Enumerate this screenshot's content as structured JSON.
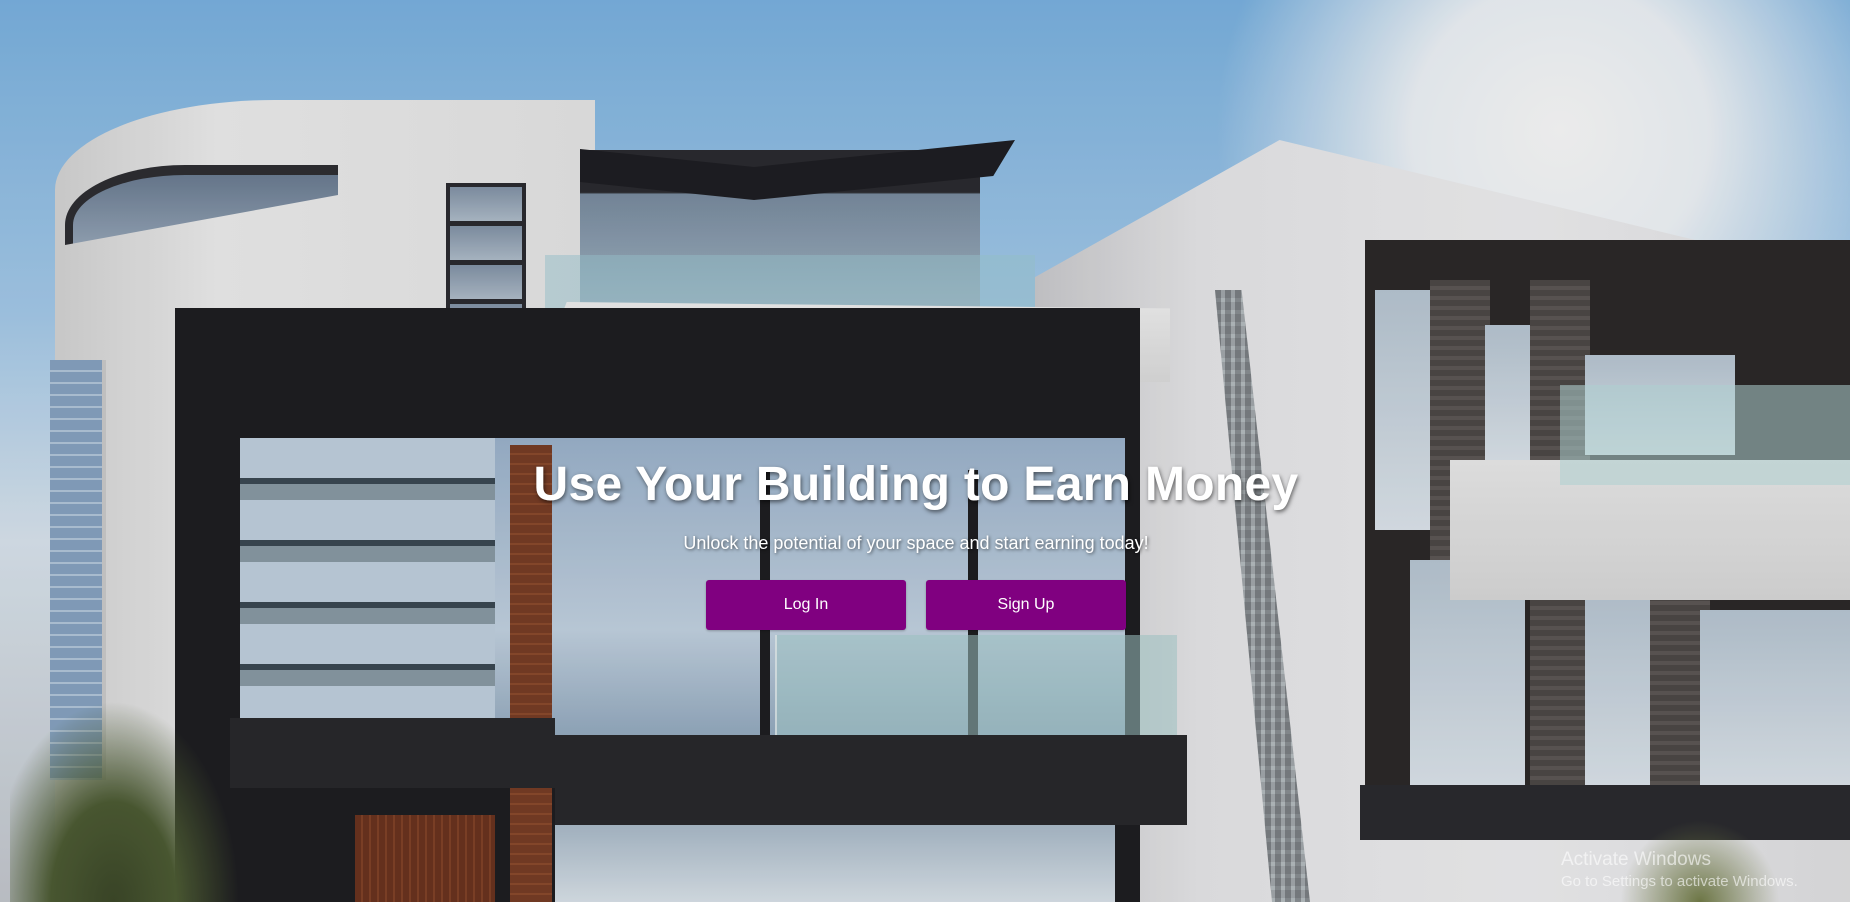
{
  "hero": {
    "title": "Use Your Building to Earn Money",
    "subtitle": "Unlock the potential of your space and start earning today!",
    "login_label": "Log In",
    "signup_label": "Sign Up"
  },
  "theme": {
    "button_color": "#800080",
    "text_color": "#ffffff"
  },
  "background": {
    "icon": "building-photo"
  },
  "watermark": {
    "title": "Activate Windows",
    "subtitle": "Go to Settings to activate Windows."
  }
}
